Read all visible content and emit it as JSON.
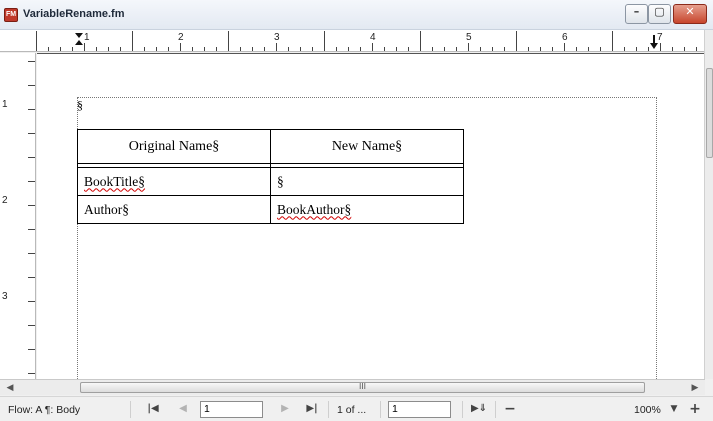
{
  "window": {
    "title": "VariableRename.fm",
    "app_icon_text": "FM",
    "minimize_glyph": "–",
    "maximize_glyph": "▢",
    "close_glyph": "✕"
  },
  "ruler": {
    "h_numbers": [
      "1",
      "2",
      "3",
      "4",
      "5",
      "6",
      "7"
    ],
    "v_numbers": [
      "1",
      "2",
      "3"
    ]
  },
  "document": {
    "paragraph_mark": "§",
    "table": {
      "headers": [
        "Original Name§",
        "New Name§"
      ],
      "rows": [
        [
          "BookTitle§",
          "§"
        ],
        [
          "Author§",
          "BookAuthor§"
        ]
      ]
    }
  },
  "hscroll": {
    "thumb_grip": "III",
    "left_arrow": "◀",
    "right_arrow": "▶"
  },
  "statusbar": {
    "flow_label": "Flow: A  ¶: Body",
    "first_page_glyph": "|◀",
    "prev_page_glyph": "◀",
    "next_page_glyph": "▶",
    "last_page_glyph": "▶|",
    "page_input_value": "1",
    "page_count": "1 of ...",
    "goto_input_value": "1",
    "goto_icon": "▶⇓",
    "zoom_out_glyph": "−",
    "zoom_label": "100%",
    "zoom_dropdown_glyph": "▼",
    "zoom_in_glyph": "+"
  }
}
